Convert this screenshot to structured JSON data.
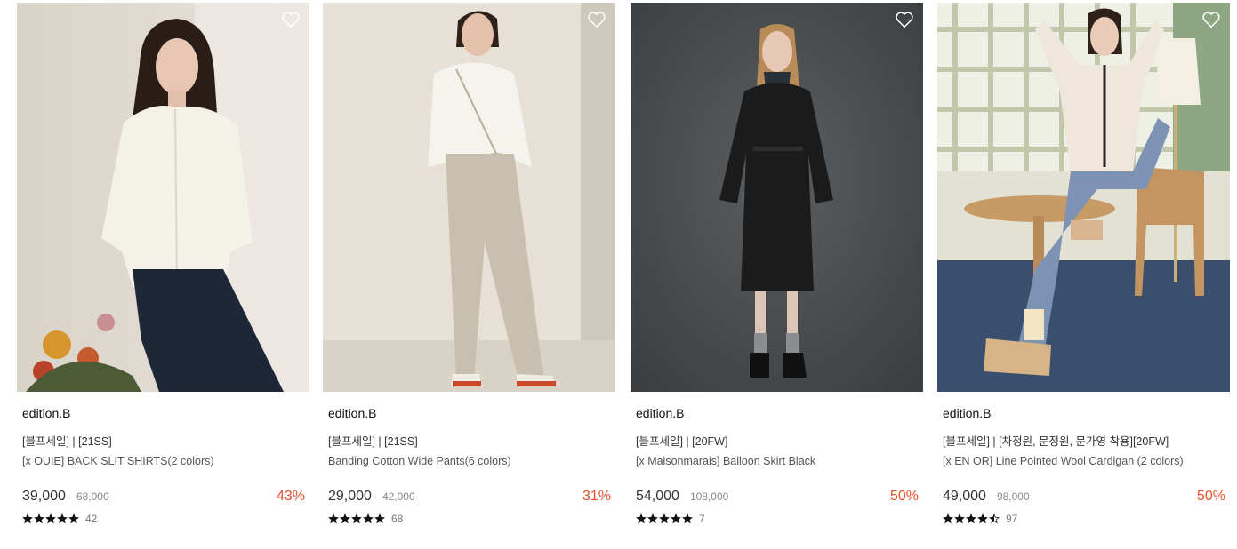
{
  "products": [
    {
      "brand": "edition.B",
      "tag": "[블프세일] | [21SS]",
      "name": "[x OUIE] BACK SLIT SHIRTS(2 colors)",
      "price": "39,000",
      "original_price": "68,000",
      "discount": "43%",
      "rating": 5,
      "review_count": "42"
    },
    {
      "brand": "edition.B",
      "tag": "[블프세일] | [21SS]",
      "name": "Banding Cotton Wide Pants(6 colors)",
      "price": "29,000",
      "original_price": "42,000",
      "discount": "31%",
      "rating": 5,
      "review_count": "68"
    },
    {
      "brand": "edition.B",
      "tag": "[블프세일] | [20FW]",
      "name": "[x Maisonmarais] Balloon Skirt Black",
      "price": "54,000",
      "original_price": "108,000",
      "discount": "50%",
      "rating": 5,
      "review_count": "7"
    },
    {
      "brand": "edition.B",
      "tag": "[블프세일] | [차정원, 문정원, 문가영 착용][20FW]",
      "name": "[x EN OR] Line Pointed Wool Cardigan (2 colors)",
      "price": "49,000",
      "original_price": "98,000",
      "discount": "50%",
      "rating": 4.5,
      "review_count": "97"
    }
  ],
  "colors": {
    "discount": "#e8512d",
    "star": "#111111"
  }
}
